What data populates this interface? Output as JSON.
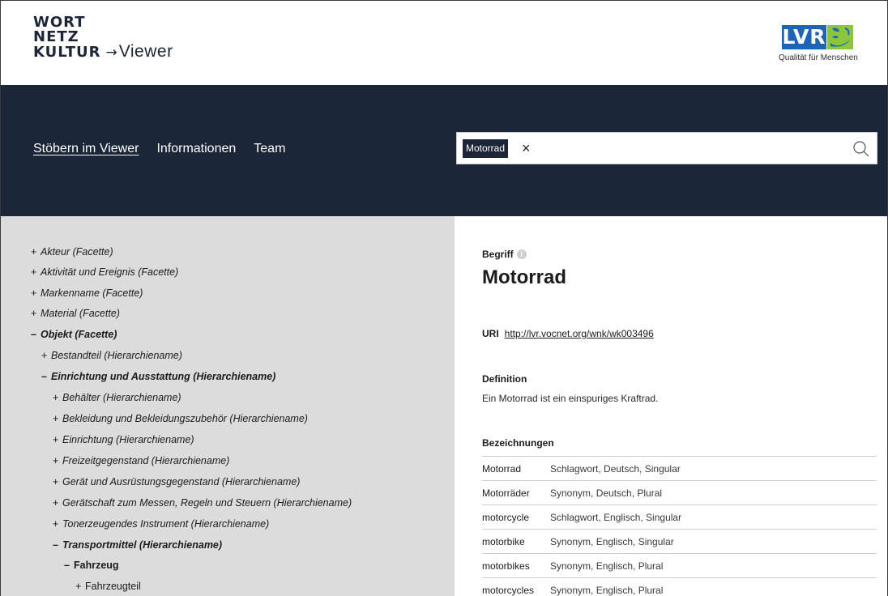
{
  "header": {
    "logo_line1": "WORT",
    "logo_line2": "NETZ",
    "logo_line3": "KULTUR",
    "logo_arrow": "→",
    "logo_viewer": "Viewer",
    "partner_logo_text": "LVR",
    "partner_tagline": "Qualität für Menschen",
    "partner_colors": {
      "blue": "#1e64b4",
      "green": "#8cc63f"
    }
  },
  "nav": {
    "items": [
      {
        "label": "Stöbern im Viewer",
        "active": true
      },
      {
        "label": "Informationen",
        "active": false
      },
      {
        "label": "Team",
        "active": false
      }
    ]
  },
  "search": {
    "chip_label": "Motorrad",
    "remove_icon": "close-icon",
    "value": "",
    "submit_icon": "search-icon"
  },
  "tree": {
    "items": [
      {
        "sign": "+",
        "label": "Akteur (Facette)",
        "level": 0,
        "bold": false,
        "italic": true
      },
      {
        "sign": "+",
        "label": "Aktivität und Ereignis (Facette)",
        "level": 0,
        "bold": false,
        "italic": true
      },
      {
        "sign": "+",
        "label": "Markenname (Facette)",
        "level": 0,
        "bold": false,
        "italic": true
      },
      {
        "sign": "+",
        "label": "Material (Facette)",
        "level": 0,
        "bold": false,
        "italic": true
      },
      {
        "sign": "–",
        "label": "Objekt (Facette)",
        "level": 0,
        "bold": true,
        "italic": true
      },
      {
        "sign": "+",
        "label": "Bestandteil (Hierarchiename)",
        "level": 1,
        "bold": false,
        "italic": true
      },
      {
        "sign": "–",
        "label": "Einrichtung und Ausstattung (Hierarchiename)",
        "level": 1,
        "bold": true,
        "italic": true
      },
      {
        "sign": "+",
        "label": "Behälter (Hierarchiename)",
        "level": 2,
        "bold": false,
        "italic": true
      },
      {
        "sign": "+",
        "label": "Bekleidung und Bekleidungszubehör (Hierarchiename)",
        "level": 2,
        "bold": false,
        "italic": true
      },
      {
        "sign": "+",
        "label": "Einrichtung (Hierarchiename)",
        "level": 2,
        "bold": false,
        "italic": true
      },
      {
        "sign": "+",
        "label": "Freizeitgegenstand (Hierarchiename)",
        "level": 2,
        "bold": false,
        "italic": true
      },
      {
        "sign": "+",
        "label": "Gerät und Ausrüstungsgegenstand (Hierarchiename)",
        "level": 2,
        "bold": false,
        "italic": true
      },
      {
        "sign": "+",
        "label": "Gerätschaft zum Messen, Regeln und Steuern (Hierarchiename)",
        "level": 2,
        "bold": false,
        "italic": true
      },
      {
        "sign": "+",
        "label": "Tonerzeugendes Instrument (Hierarchiename)",
        "level": 2,
        "bold": false,
        "italic": true
      },
      {
        "sign": "–",
        "label": "Transportmittel (Hierarchiename)",
        "level": 2,
        "bold": true,
        "italic": true
      },
      {
        "sign": "–",
        "label": "Fahrzeug",
        "level": 3,
        "bold": true,
        "italic": false
      },
      {
        "sign": "+",
        "label": "Fahrzeugteil",
        "level": 4,
        "bold": false,
        "italic": false
      }
    ]
  },
  "detail": {
    "type_label": "Begriff",
    "info_icon": "i",
    "title": "Motorrad",
    "uri_label": "URI",
    "uri_value": "http://lvr.vocnet.org/wnk/wk003496",
    "definition_label": "Definition",
    "definition_text": "Ein Motorrad ist ein einspuriges Kraftrad.",
    "designations_label": "Bezeichnungen",
    "designations": [
      {
        "term": "Motorrad",
        "meta": "Schlagwort, Deutsch, Singular"
      },
      {
        "term": "Motorräder",
        "meta": "Synonym, Deutsch, Plural"
      },
      {
        "term": "motorcycle",
        "meta": "Schlagwort, Englisch, Singular"
      },
      {
        "term": "motorbike",
        "meta": "Synonym, Englisch, Singular"
      },
      {
        "term": "motorbikes",
        "meta": "Synonym, Englisch, Plural"
      },
      {
        "term": "motorcycles",
        "meta": "Synonym, Englisch, Plural"
      }
    ]
  }
}
